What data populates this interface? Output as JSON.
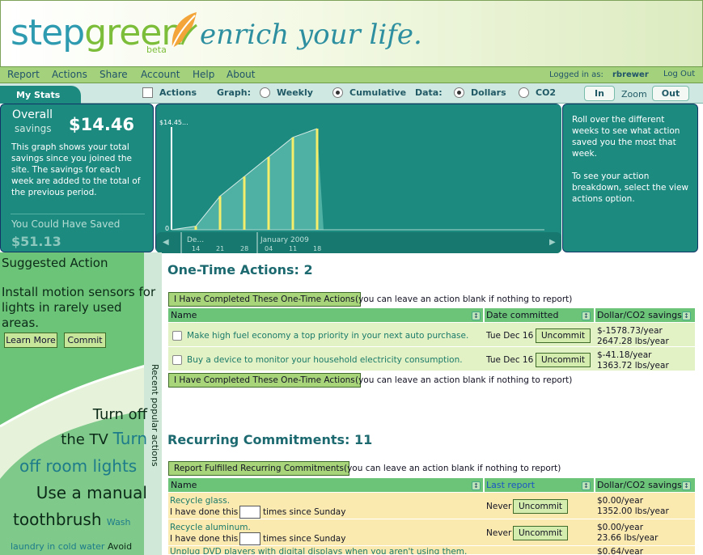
{
  "brand": {
    "logo": "stepgreen",
    "logo_part1": "step",
    "logo_part2": "green",
    "beta": "beta",
    "tagline": "enrich your life."
  },
  "menu": {
    "items": [
      "Report",
      "Actions",
      "Share",
      "Account",
      "Help",
      "About"
    ],
    "login_label": "Logged in as:",
    "user": "rbrewer",
    "logout": "Log Out"
  },
  "stats_bar": {
    "tab": "My Stats",
    "actions_label": "Actions",
    "graph_label": "Graph:",
    "weekly": "Weekly",
    "cumulative": "Cumulative",
    "data_label": "Data:",
    "dollars": "Dollars",
    "co2": "CO2",
    "zoom_in": "In",
    "zoom_label": "Zoom",
    "zoom_out": "Out"
  },
  "stats": {
    "overall_label": "Overall",
    "savings_label": "savings",
    "savings_value": "$14.46",
    "description": "This graph shows your total savings since you joined the site. The savings for each week are added to the total of the previous period.",
    "could_label": "You Could Have Saved",
    "could_value": "$51.13"
  },
  "chart_data": {
    "type": "area",
    "peak_label": "$14.45...",
    "zero_label": "0",
    "x_month_labels": [
      "De...",
      "January 2009"
    ],
    "x_tick_labels": [
      "14",
      "21",
      "28",
      "04",
      "11",
      "18"
    ],
    "values": [
      0,
      0.5,
      4.8,
      7.6,
      10.4,
      13.2,
      14.45
    ]
  },
  "help_text": {
    "line1": "Roll over the different weeks to see what action saved you the most that week.",
    "line2": "To see your action breakdown, select the view actions option."
  },
  "sidebar": {
    "title": "Suggested Action",
    "text": "Install motion sensors for lights in rarely used areas.",
    "learn_more": "Learn More",
    "commit": "Commit",
    "vertical_label": "Recent popular actions",
    "cloud": {
      "w1": "Turn off",
      "w2": "the TV",
      "w3": "Turn",
      "w4": "off room lights",
      "w5": "Use a manual",
      "w6": "toothbrush",
      "w7": "Wash",
      "w8": "laundry in cold water",
      "w9": "Avoid"
    }
  },
  "one_time": {
    "heading": "One-Time Actions: 2",
    "button": "I Have Completed These One-Time Actions",
    "note": "(you can leave an action blank if nothing to report)",
    "columns": [
      "Name",
      "Date committed",
      "Dollar/CO2 savings"
    ],
    "rows": [
      {
        "name": "Make high fuel economy a top priority in your next auto purchase.",
        "date": "Tue Dec 16",
        "uncommit": "Uncommit",
        "dollars": "$-1578.73/year",
        "co2": "2647.28 lbs/year"
      },
      {
        "name": "Buy a device to monitor your household electricity consumption.",
        "date": "Tue Dec 16",
        "uncommit": "Uncommit",
        "dollars": "$-41.18/year",
        "co2": "1363.72 lbs/year"
      }
    ]
  },
  "recurring": {
    "heading": "Recurring Commitments: 11",
    "button": "Report Fulfilled Recurring Commitments",
    "note": "(you can leave an action blank if nothing to report)",
    "columns": [
      "Name",
      "Last report",
      "Dollar/CO2 savings"
    ],
    "rows": [
      {
        "name": "Recycle glass.",
        "done_pre": "I have done this",
        "done_post": "times since Sunday",
        "last": "Never",
        "uncommit": "Uncommit",
        "dollars": "$0.00/year",
        "co2": "1352.00 lbs/year"
      },
      {
        "name": "Recycle aluminum.",
        "done_pre": "I have done this",
        "done_post": "times since Sunday",
        "last": "Never",
        "uncommit": "Uncommit",
        "dollars": "$0.00/year",
        "co2": "23.66 lbs/year"
      },
      {
        "name": "Unplug DVD players with digital displays when you aren't using them.",
        "dollars": "$0.64/year"
      }
    ]
  },
  "colors": {
    "teal": "#1d8a80",
    "green": "#6cc478",
    "light_green": "#e3f2c4",
    "recurring_row": "#faeab0",
    "link": "#1a55c4"
  }
}
